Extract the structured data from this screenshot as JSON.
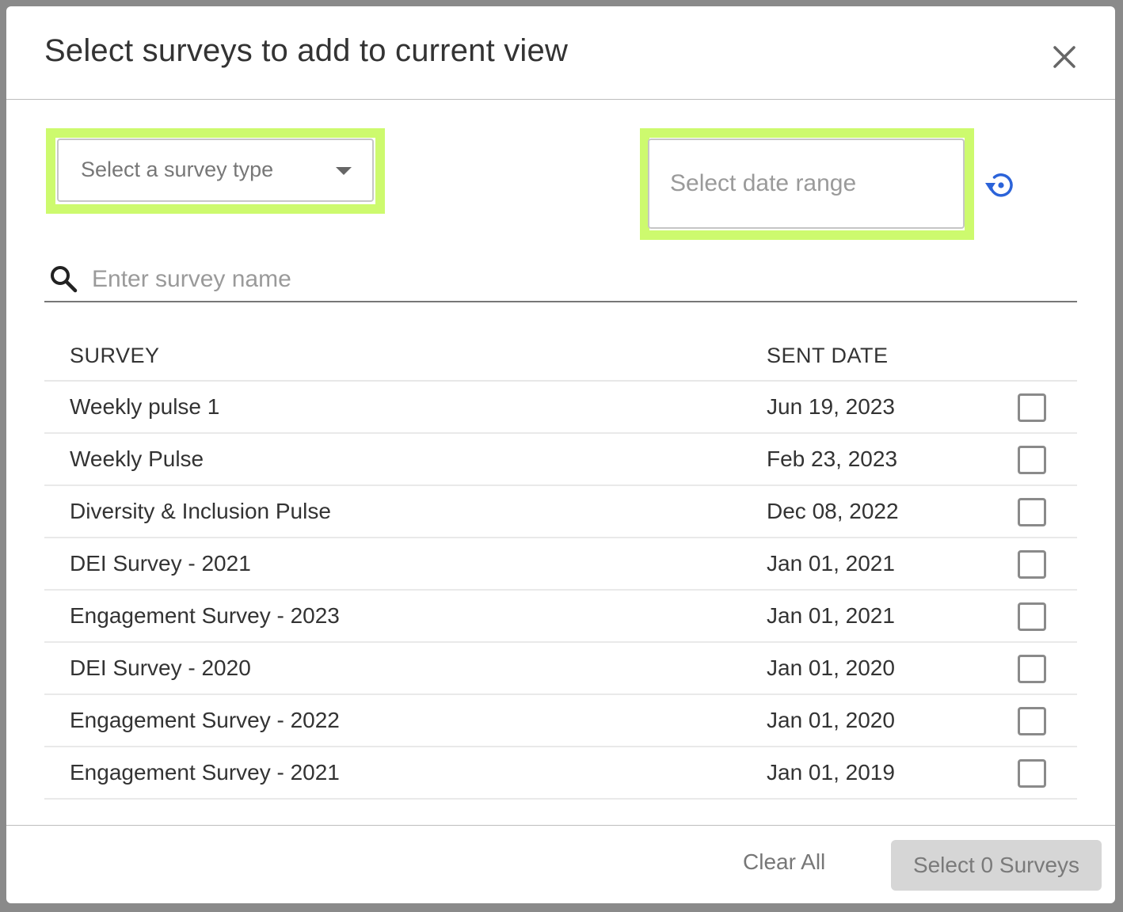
{
  "modal": {
    "title": "Select surveys to add to current view"
  },
  "filters": {
    "survey_type_placeholder": "Select a survey type",
    "date_range_placeholder": "Select date range",
    "highlight_color": "#cdfa6e",
    "reset_icon_color": "#2b63d9"
  },
  "search": {
    "placeholder": "Enter survey name"
  },
  "table": {
    "headers": {
      "survey": "SURVEY",
      "sent_date": "SENT DATE"
    },
    "rows": [
      {
        "name": "Weekly pulse 1",
        "sent_date": "Jun 19, 2023",
        "checked": false
      },
      {
        "name": "Weekly Pulse",
        "sent_date": "Feb 23, 2023",
        "checked": false
      },
      {
        "name": "Diversity & Inclusion Pulse",
        "sent_date": "Dec 08, 2022",
        "checked": false
      },
      {
        "name": "DEI Survey - 2021",
        "sent_date": "Jan 01, 2021",
        "checked": false
      },
      {
        "name": "Engagement Survey - 2023",
        "sent_date": "Jan 01, 2021",
        "checked": false
      },
      {
        "name": "DEI Survey - 2020",
        "sent_date": "Jan 01, 2020",
        "checked": false
      },
      {
        "name": "Engagement Survey - 2022",
        "sent_date": "Jan 01, 2020",
        "checked": false
      },
      {
        "name": "Engagement Survey - 2021",
        "sent_date": "Jan 01, 2019",
        "checked": false
      }
    ]
  },
  "footer": {
    "clear_label": "Clear All",
    "select_label": "Select 0 Surveys"
  }
}
